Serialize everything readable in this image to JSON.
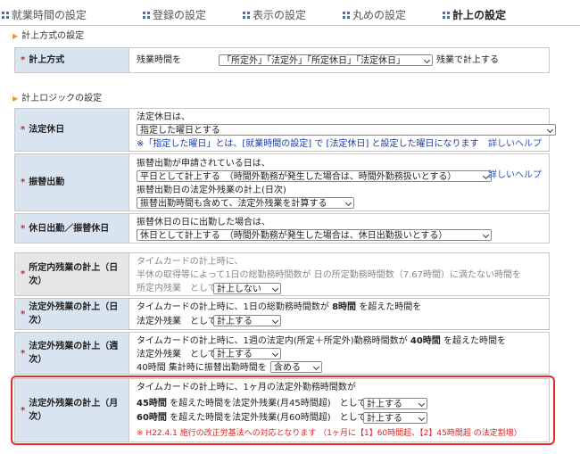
{
  "tabs": [
    {
      "label": "就業時間の設定"
    },
    {
      "label": "登録の設定"
    },
    {
      "label": "表示の設定"
    },
    {
      "label": "丸めの設定"
    },
    {
      "label": "計上の設定"
    }
  ],
  "sections": {
    "method": "計上方式の設定",
    "logic": "計上ロジックの設定"
  },
  "method_row": {
    "label": "計上方式",
    "prefix": "残業時間を",
    "select": "「所定外」「法定外」「所定休日」「法定休日」",
    "suffix": "残業で計上する"
  },
  "legal_holiday": {
    "label": "法定休日",
    "text": "法定休日は、",
    "select": "指定した曜日とする",
    "note": "※「指定した曜日」とは、[就業時間の設定] で [法定休日] と設定した曜日になります",
    "help": "詳しいヘルプ"
  },
  "substitute_work": {
    "label": "振替出勤",
    "text1": "振替出勤が申請されている日は、",
    "select1": "平日として計上する　（時間外勤務が発生した場合は、時間外勤務扱いとする）",
    "text2": "振替出勤日の法定外残業の計上(日次)",
    "select2": "振替出勤時間も含めて、法定外残業を計算する",
    "help": "詳しいヘルプ"
  },
  "holiday_work": {
    "label": "休日出勤／振替休日",
    "text": "振替休日の日に出勤した場合は、",
    "select": "休日として計上する　（時間外勤務が発生した場合は、休日出勤扱いとする）"
  },
  "in_ot_daily": {
    "label": "所定内残業の計上（日次）",
    "line1": "タイムカードの計上時に、",
    "line2": "半休の取得等によって1日の総勤務時間数が 日の所定勤務時間数（7.67時間）に満たない時間を",
    "line3a": "所定内残業　として",
    "select": "計上しない"
  },
  "out_ot_daily": {
    "label": "法定外残業の計上（日次）",
    "line1a": "タイムカードの計上時に、1日の総勤務時間数が",
    "hours": "8時間",
    "line1b": "を超えた時間を",
    "line2a": "法定外残業　として",
    "select": "計上する"
  },
  "out_ot_weekly": {
    "label": "法定外残業の計上（週次）",
    "line1a": "タイムカードの計上時に、1週の法定内(所定＋所定外)勤務時間数が",
    "hours": "40時間",
    "line1b": "を超えた時間を",
    "line2a": "法定外残業　として",
    "select1": "計上する",
    "line3a": "40時間 集計時に振替出勤時間を",
    "select2": "含める"
  },
  "out_ot_monthly": {
    "label": "法定外残業の計上（月次）",
    "line1": "タイムカードの計上時に、1ヶ月の法定外勤務時間数が",
    "h45": "45時間",
    "t45": "を超えた時間を法定外残業(月45時間超)　として",
    "select45": "計上する",
    "h60": "60時間",
    "t60": "を超えた時間を法定外残業(月60時間超)　として",
    "select60": "計上する",
    "warn": "※ H22.4.1 施行の改正労基法への対応となります （1ヶ月に【1】60時間超、【2】45時間超 の法定割増）"
  },
  "colors": {
    "label_bg": "#d9e4f1",
    "highlight": "#e62c2c",
    "note": "#1a3ba8",
    "warn": "#d22222"
  }
}
